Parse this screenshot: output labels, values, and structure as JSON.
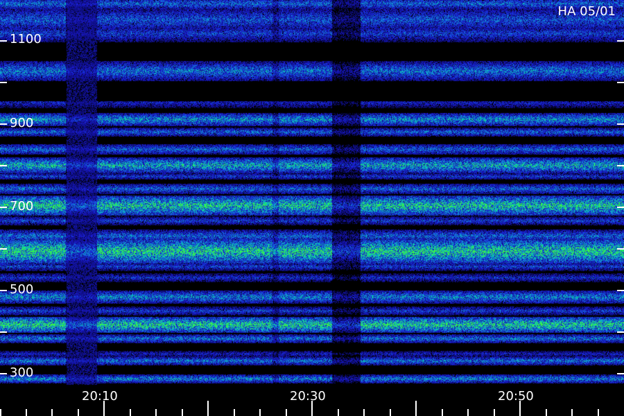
{
  "station_label": "HA 05/01",
  "y_axis": {
    "labels": [
      "1100",
      "900",
      "700",
      "500",
      "300"
    ]
  },
  "x_axis": {
    "labels": [
      "20:10",
      "20:30",
      "20:50"
    ]
  },
  "colors": {
    "background": "#000000",
    "low": "#1a1acc",
    "mid": "#00bcd8",
    "high": "#22e04a",
    "text": "#ffffff"
  }
}
